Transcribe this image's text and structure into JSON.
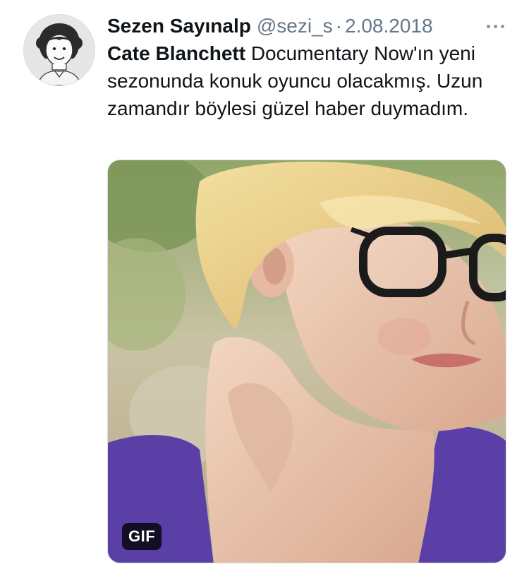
{
  "tweet": {
    "display_name": "Sezen Sayınalp",
    "handle": "@sezi_s",
    "separator": "·",
    "date": "2.08.2018",
    "more_icon": "more-horizontal-icon",
    "text_bold": "Cate Blanchett",
    "text_rest": " Documentary Now'ın yeni sezonunda konuk oyuncu olacakmış. Uzun zamandır böylesi güzel haber duymadım.",
    "media": {
      "badge": "GIF"
    }
  },
  "colors": {
    "text": "#0f1419",
    "secondary": "#657786",
    "badge_bg": "#000000"
  }
}
